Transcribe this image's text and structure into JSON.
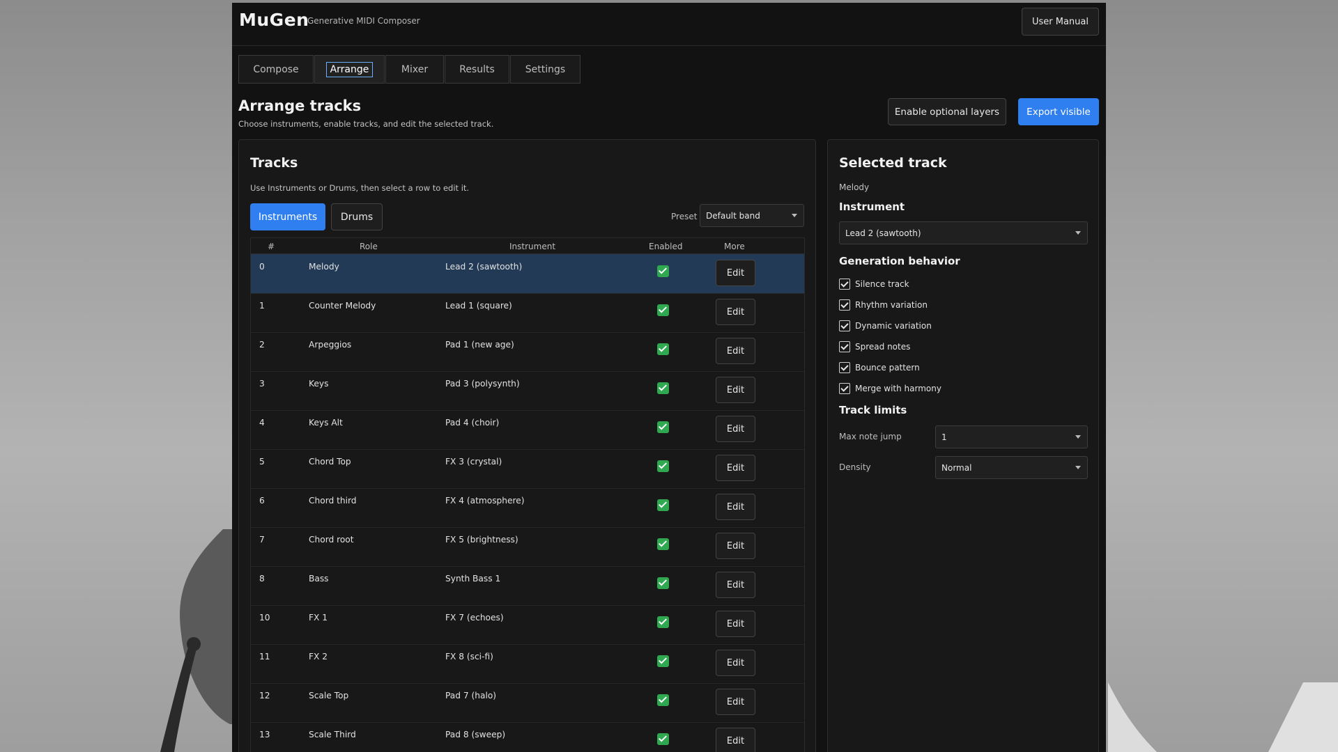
{
  "app": {
    "name": "MuGen",
    "tagline": "Generative MIDI Composer",
    "manual_label": "User Manual"
  },
  "tabs": [
    {
      "label": "Compose",
      "active": false
    },
    {
      "label": "Arrange",
      "active": true
    },
    {
      "label": "Mixer",
      "active": false
    },
    {
      "label": "Results",
      "active": false
    },
    {
      "label": "Settings",
      "active": false
    }
  ],
  "page": {
    "title": "Arrange tracks",
    "subtitle": "Choose instruments, enable tracks, and edit the selected track.",
    "optional_layers_label": "Enable optional layers",
    "export_label": "Export visible"
  },
  "tracks": {
    "title": "Tracks",
    "note": "Use Instruments or Drums, then select a row to edit it.",
    "seg_instruments": "Instruments",
    "seg_drums": "Drums",
    "preset_label": "Preset",
    "preset_value": "Default band",
    "columns": {
      "num": "#",
      "role": "Role",
      "instrument": "Instrument",
      "enabled": "Enabled",
      "more": "More"
    },
    "edit_label": "Edit",
    "rows": [
      {
        "num": "0",
        "role": "Melody",
        "instrument": "Lead 2 (sawtooth)",
        "enabled": true,
        "selected": true
      },
      {
        "num": "1",
        "role": "Counter Melody",
        "instrument": "Lead 1 (square)",
        "enabled": true
      },
      {
        "num": "2",
        "role": "Arpeggios",
        "instrument": "Pad 1 (new age)",
        "enabled": true
      },
      {
        "num": "3",
        "role": "Keys",
        "instrument": "Pad 3 (polysynth)",
        "enabled": true
      },
      {
        "num": "4",
        "role": "Keys Alt",
        "instrument": "Pad 4 (choir)",
        "enabled": true
      },
      {
        "num": "5",
        "role": "Chord Top",
        "instrument": "FX 3 (crystal)",
        "enabled": true
      },
      {
        "num": "6",
        "role": "Chord third",
        "instrument": "FX 4 (atmosphere)",
        "enabled": true
      },
      {
        "num": "7",
        "role": "Chord root",
        "instrument": "FX 5 (brightness)",
        "enabled": true
      },
      {
        "num": "8",
        "role": "Bass",
        "instrument": "Synth Bass 1",
        "enabled": true
      },
      {
        "num": "10",
        "role": "FX 1",
        "instrument": "FX 7 (echoes)",
        "enabled": true
      },
      {
        "num": "11",
        "role": "FX 2",
        "instrument": "FX 8 (sci-fi)",
        "enabled": true
      },
      {
        "num": "12",
        "role": "Scale Top",
        "instrument": "Pad 7 (halo)",
        "enabled": true
      },
      {
        "num": "13",
        "role": "Scale Third",
        "instrument": "Pad 8 (sweep)",
        "enabled": true
      }
    ]
  },
  "selected": {
    "title": "Selected track",
    "track_name": "Melody",
    "instrument_heading": "Instrument",
    "instrument_value": "Lead 2 (sawtooth)",
    "behavior_heading": "Generation behavior",
    "behaviors": [
      {
        "label": "Silence track",
        "checked": true
      },
      {
        "label": "Rhythm variation",
        "checked": true
      },
      {
        "label": "Dynamic variation",
        "checked": true
      },
      {
        "label": "Spread notes",
        "checked": true
      },
      {
        "label": "Bounce pattern",
        "checked": true
      },
      {
        "label": "Merge with harmony",
        "checked": true
      }
    ],
    "limits_heading": "Track limits",
    "limits": [
      {
        "label": "Max note jump",
        "value": "1"
      },
      {
        "label": "Density",
        "value": "Normal"
      }
    ]
  }
}
